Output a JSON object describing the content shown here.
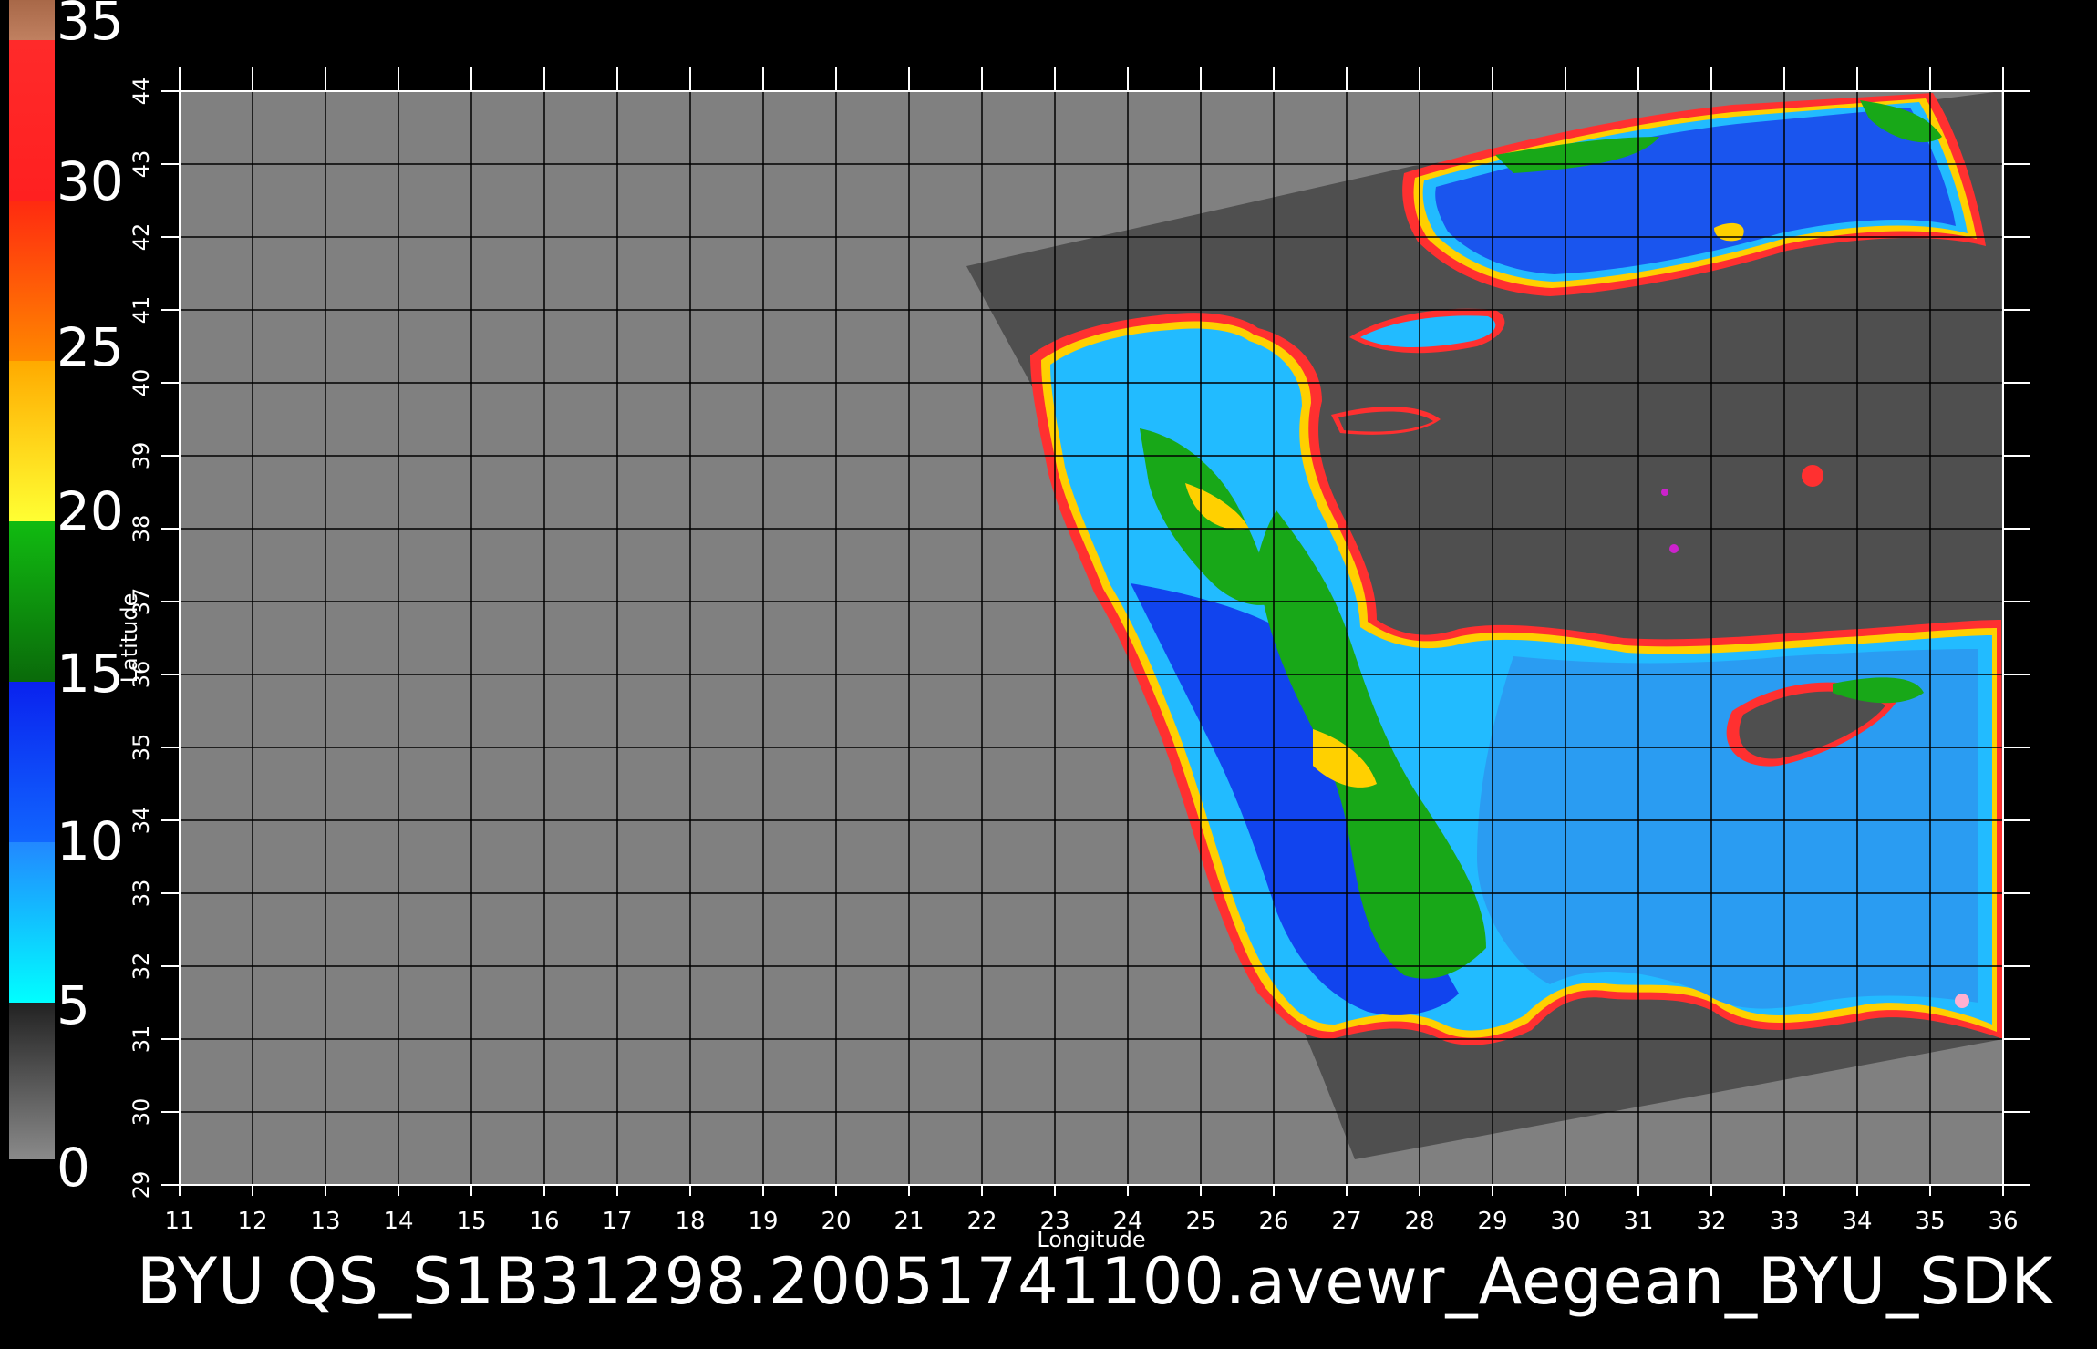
{
  "colorbar": {
    "labels": [
      "35",
      "30",
      "25",
      "20",
      "15",
      "10",
      "5",
      "0"
    ],
    "colors": {
      "0-5": "#6a6a6a",
      "5-10": "#22aaff",
      "10-15": "#1144ee",
      "15-20": "#119911",
      "20-25": "#ffcc00",
      "25-30": "#ff5500",
      "30-35": "#ff1a1a",
      "35+": "#c08060"
    }
  },
  "map": {
    "xlabel": "Longitude",
    "ylabel": "Latitude",
    "lon_ticks": [
      "11",
      "12",
      "13",
      "14",
      "15",
      "16",
      "17",
      "18",
      "19",
      "20",
      "21",
      "22",
      "23",
      "24",
      "25",
      "26",
      "27",
      "28",
      "29",
      "30",
      "31",
      "32",
      "33",
      "34",
      "35",
      "36"
    ],
    "lat_ticks": [
      "29",
      "30",
      "31",
      "32",
      "33",
      "34",
      "35",
      "36",
      "37",
      "38",
      "39",
      "40",
      "41",
      "42",
      "43",
      "44"
    ],
    "lon_range": [
      11,
      36
    ],
    "lat_range": [
      29,
      44
    ],
    "background_color": "#808080",
    "land_color": "#4f4f4f",
    "grid_color": "#000000"
  },
  "footer": {
    "title": "BYU  QS_S1B31298.20051741100.avewr_Aegean_BYU_SDK"
  }
}
